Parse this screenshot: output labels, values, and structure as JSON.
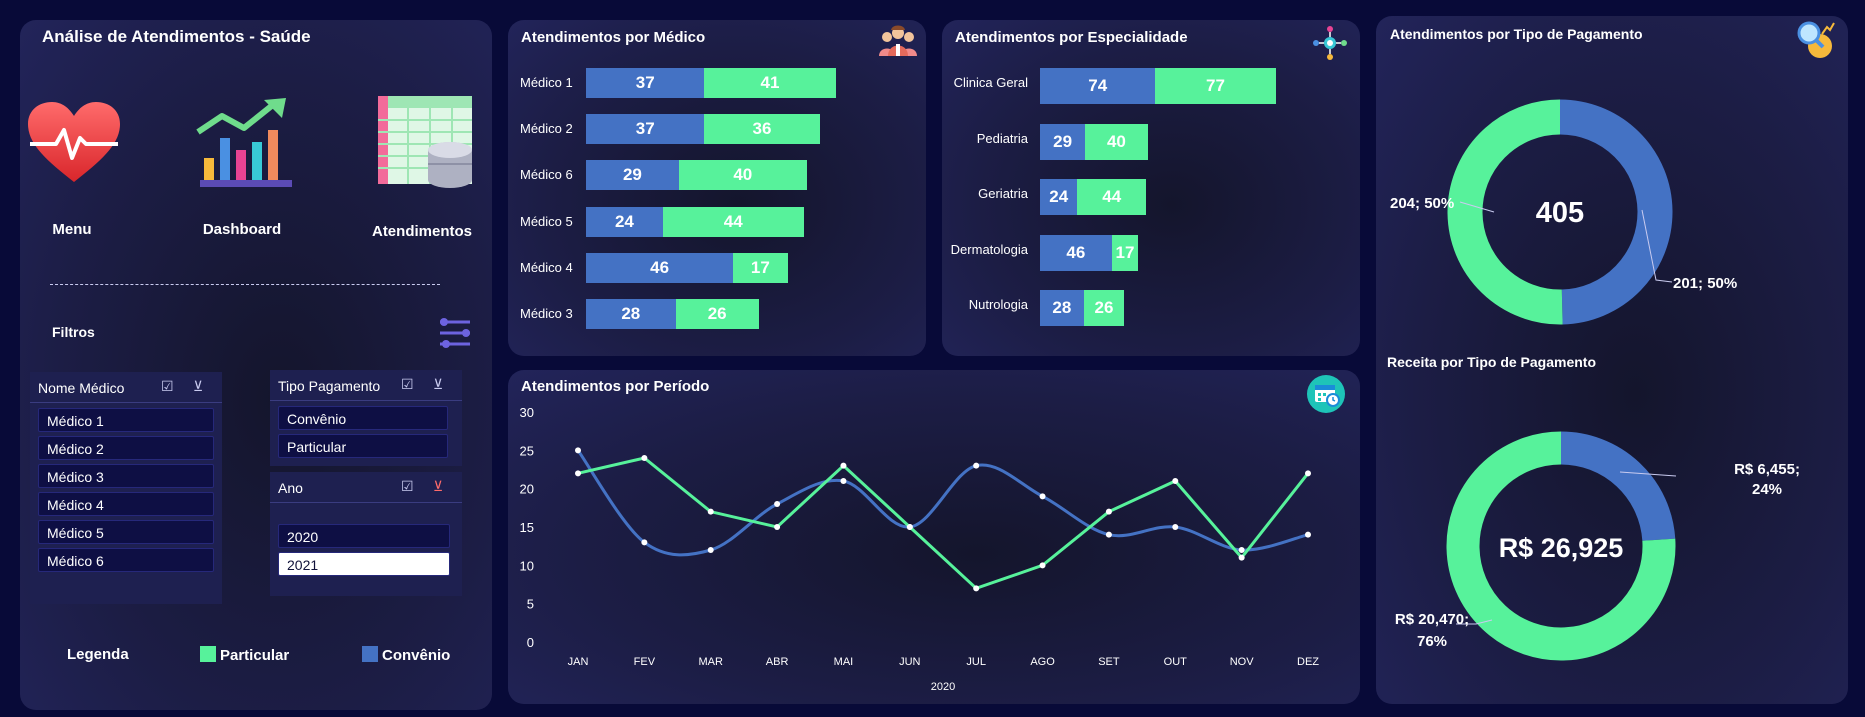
{
  "app": {
    "title": "Análise de Atendimentos - Saúde",
    "nav": [
      {
        "label": "Menu",
        "icon": "heart-pulse-icon"
      },
      {
        "label": "Dashboard",
        "icon": "growth-chart-icon"
      },
      {
        "label": "Atendimentos",
        "icon": "spreadsheet-database-icon"
      }
    ],
    "filters_label": "Filtros"
  },
  "colors": {
    "particular": "#57f29b",
    "convenio": "#4472c4",
    "background": "#080a38",
    "panel": "#1c1d45"
  },
  "slicers": {
    "medico": {
      "title": "Nome Médico",
      "items": [
        "Médico 1",
        "Médico 2",
        "Médico 3",
        "Médico 4",
        "Médico 5",
        "Médico 6"
      ]
    },
    "pagamento": {
      "title": "Tipo Pagamento",
      "items": [
        "Convênio",
        "Particular"
      ]
    },
    "ano": {
      "title": "Ano",
      "items": [
        "2020",
        "2021"
      ],
      "selected": "2021"
    }
  },
  "legend": {
    "title": "Legenda",
    "particular": "Particular",
    "convenio": "Convênio"
  },
  "chart_data": [
    {
      "id": "medico",
      "type": "bar",
      "title": "Atendimentos por Médico",
      "categories": [
        "Médico 1",
        "Médico 2",
        "Médico 6",
        "Médico 5",
        "Médico 4",
        "Médico 3"
      ],
      "series": [
        {
          "name": "Convênio",
          "values": [
            37,
            37,
            29,
            24,
            46,
            28
          ]
        },
        {
          "name": "Particular",
          "values": [
            41,
            36,
            40,
            44,
            17,
            26
          ]
        }
      ]
    },
    {
      "id": "especialidade",
      "type": "bar",
      "title": "Atendimentos por Especialidade",
      "categories": [
        "Clinica Geral",
        "Pediatria",
        "Geriatria",
        "Dermatologia",
        "Nutrologia"
      ],
      "series": [
        {
          "name": "Convênio",
          "values": [
            74,
            29,
            24,
            46,
            28
          ]
        },
        {
          "name": "Particular",
          "values": [
            77,
            40,
            44,
            17,
            26
          ]
        }
      ]
    },
    {
      "id": "periodo",
      "type": "line",
      "title": "Atendimentos por Período",
      "xlabel": "2020",
      "categories": [
        "JAN",
        "FEV",
        "MAR",
        "ABR",
        "MAI",
        "JUN",
        "JUL",
        "AGO",
        "SET",
        "OUT",
        "NOV",
        "DEZ"
      ],
      "ylim": [
        0,
        30
      ],
      "yticks": [
        "0",
        "5",
        "10",
        "15",
        "20",
        "25",
        "30"
      ],
      "series": [
        {
          "name": "Convênio",
          "values": [
            25,
            13,
            12,
            18,
            21,
            15,
            23,
            19,
            14,
            15,
            12,
            14
          ]
        },
        {
          "name": "Particular",
          "values": [
            22,
            24,
            17,
            15,
            23,
            15,
            7,
            10,
            17,
            21,
            11,
            22
          ]
        }
      ]
    },
    {
      "id": "tipo_pagamento",
      "type": "pie",
      "title": "Atendimentos por Tipo de Pagamento",
      "center_label": "405",
      "slices": [
        {
          "name": "Convênio",
          "value": 201,
          "label": "201; 50%"
        },
        {
          "name": "Particular",
          "value": 204,
          "label": "204; 50%"
        }
      ]
    },
    {
      "id": "receita",
      "type": "pie",
      "title": "Receita por Tipo de Pagamento",
      "center_label": "R$ 26,925",
      "slices": [
        {
          "name": "Convênio",
          "value": 6455,
          "label_line1": "R$ 6,455;",
          "label_line2": "24%"
        },
        {
          "name": "Particular",
          "value": 20470,
          "label_line1": "R$ 20,470;",
          "label_line2": "76%"
        }
      ]
    }
  ]
}
